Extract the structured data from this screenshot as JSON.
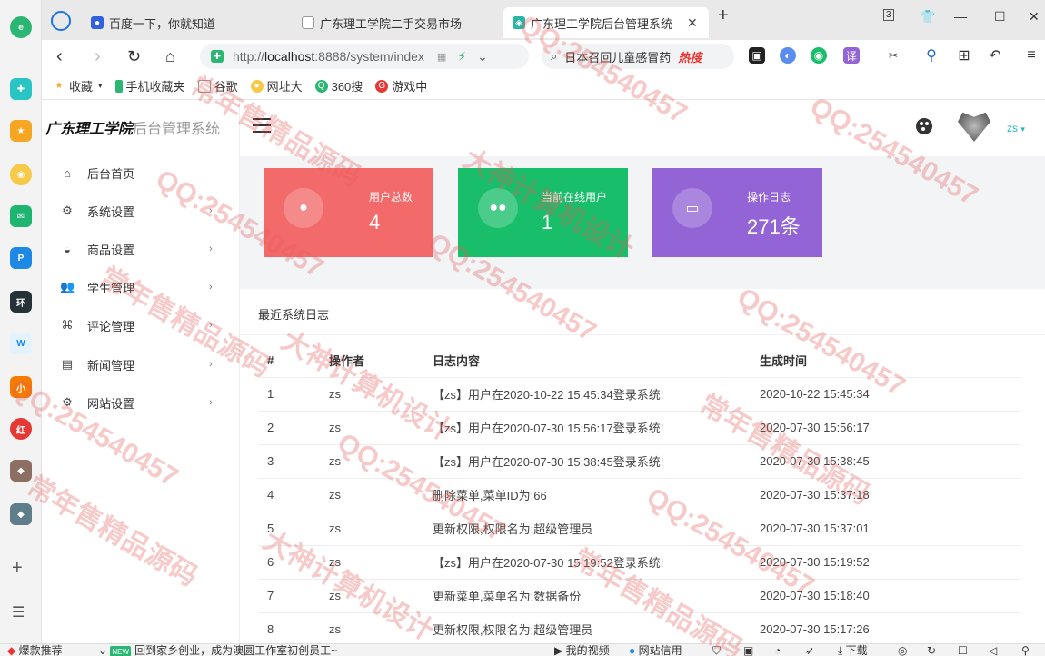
{
  "browser": {
    "tabs": [
      {
        "label": "百度一下，你就知道",
        "icon": "baidu-icon"
      },
      {
        "label": "广东理工学院二手交易市场-",
        "icon": "page-icon"
      },
      {
        "label": "广东理工学院后台管理系统",
        "icon": "site-icon",
        "active": true
      }
    ],
    "tab_count": "3",
    "url": {
      "prefix": "http://",
      "host": "localhost",
      "rest": ":8888/system/index"
    },
    "search_text": "日本召回儿童感冒药",
    "search_hot": "热搜",
    "translate_label": "译",
    "bookmarks": [
      "收藏",
      "手机收藏夹",
      "谷歌",
      "网址大",
      "360搜",
      "游戏中"
    ]
  },
  "app": {
    "brand_bold": "广东理工学院",
    "brand_rest": "后台管理系统",
    "user": "zs",
    "menu": [
      {
        "label": "后台首页",
        "icon": "home-icon",
        "has_arrow": false
      },
      {
        "label": "系统设置",
        "icon": "gear-icon",
        "has_arrow": true
      },
      {
        "label": "商品设置",
        "icon": "basket-icon",
        "has_arrow": true
      },
      {
        "label": "学生管理",
        "icon": "users-icon",
        "has_arrow": true
      },
      {
        "label": "评论管理",
        "icon": "command-icon",
        "has_arrow": true
      },
      {
        "label": "新闻管理",
        "icon": "news-icon",
        "has_arrow": true
      },
      {
        "label": "网站设置",
        "icon": "gear-icon",
        "has_arrow": true
      }
    ],
    "cards": [
      {
        "label": "用户总数",
        "value": "4",
        "color": "#f36a6a",
        "icon": "user-icon"
      },
      {
        "label": "当前在线用户",
        "value": "1",
        "color": "#19be6b",
        "icon": "users-icon"
      },
      {
        "label": "操作日志",
        "value": "271条",
        "color": "#9264d6",
        "icon": "keyboard-icon"
      }
    ],
    "log_panel": {
      "title": "最近系统日志",
      "columns": [
        "#",
        "操作者",
        "日志内容",
        "生成时间"
      ],
      "rows": [
        [
          "1",
          "zs",
          "【zs】用户在2020-10-22 15:45:34登录系统!",
          "2020-10-22 15:45:34"
        ],
        [
          "2",
          "zs",
          "【zs】用户在2020-07-30 15:56:17登录系统!",
          "2020-07-30 15:56:17"
        ],
        [
          "3",
          "zs",
          "【zs】用户在2020-07-30 15:38:45登录系统!",
          "2020-07-30 15:38:45"
        ],
        [
          "4",
          "zs",
          "删除菜单,菜单ID为:66",
          "2020-07-30 15:37:18"
        ],
        [
          "5",
          "zs",
          "更新权限,权限名为:超级管理员",
          "2020-07-30 15:37:01"
        ],
        [
          "6",
          "zs",
          "【zs】用户在2020-07-30 15:19:52登录系统!",
          "2020-07-30 15:19:52"
        ],
        [
          "7",
          "zs",
          "更新菜单,菜单名为:数据备份",
          "2020-07-30 15:18:40"
        ],
        [
          "8",
          "zs",
          "更新权限,权限名为:超级管理员",
          "2020-07-30 15:17:26"
        ]
      ]
    }
  },
  "statusbar": {
    "items": [
      "爆款推荐",
      "回到家乡创业，成为澳圆工作室初创员工~",
      "我的视频",
      "网站信用",
      "下载"
    ],
    "new_tag": "NEW"
  },
  "watermarks": [
    "QQ:254540457",
    "常年售精品源码",
    "大神计算机设计"
  ]
}
